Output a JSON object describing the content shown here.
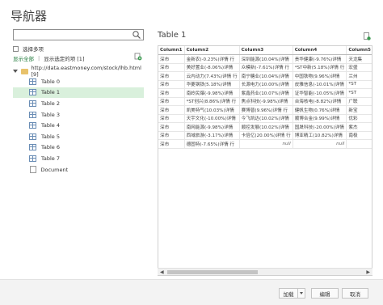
{
  "navigator": {
    "title": "导航器",
    "search_placeholder": "",
    "multi_select_label": "选择多项",
    "show_all_label": "显示全部",
    "show_selected_label": "显示选定的项 [1]",
    "tree": {
      "root_label": "http://data.eastmoney.com/stock/lhb.html [9]",
      "items": [
        {
          "label": "Table 0",
          "type": "table",
          "selected": false
        },
        {
          "label": "Table 1",
          "type": "table",
          "selected": true
        },
        {
          "label": "Table 2",
          "type": "table",
          "selected": false
        },
        {
          "label": "Table 3",
          "type": "table",
          "selected": false
        },
        {
          "label": "Table 4",
          "type": "table",
          "selected": false
        },
        {
          "label": "Table 5",
          "type": "table",
          "selected": false
        },
        {
          "label": "Table 6",
          "type": "table",
          "selected": false
        },
        {
          "label": "Table 7",
          "type": "table",
          "selected": false
        },
        {
          "label": "Document",
          "type": "document",
          "selected": false
        }
      ]
    }
  },
  "preview": {
    "title": "Table 1",
    "columns": [
      "Column1",
      "Column2",
      "Column3",
      "Column4",
      "Column5"
    ],
    "rows": [
      [
        "深市",
        "金新农(-0.23%)详情 行",
        "深圳能源(10.04%)详情",
        "贵华健康(-9.76%)详情",
        "天龙集"
      ],
      [
        "深市",
        "美好置业(-8.06%)详情",
        "众模新(-7.61%)详情 行",
        "*ST中新(5.18%)详情 行",
        "宏盛"
      ],
      [
        "深市",
        "云内动力(7.43%)详情 行",
        "南宁糖业(10.04%)详情",
        "中国铁物(9.96%)详情",
        "兰州"
      ],
      [
        "深市",
        "华菱钢铁(5.18%)详情",
        "长源电力(10.00%)详情",
        "皮雅信息(-10.01%)详情",
        "*ST"
      ],
      [
        "深市",
        "南岭民爆(-9.98%)详情",
        "紫鑫药业(10.07%)详情",
        "证华智能(-10.05%)详情",
        "*ST"
      ],
      [
        "深市",
        "*ST创兴(8.86%)详情 行",
        "焦点科技(-9.98%)详情",
        "台海核电(-8.82%)详情",
        "广联"
      ],
      [
        "深市",
        "凯美特气(10.03%)详情",
        "赛博普(9.96%)详情 行",
        "健帆生物(0.76%)详情",
        "新宝"
      ],
      [
        "深市",
        "天宇文化(-10.00%)详情",
        "今飞凯达(10.02%)详情",
        "顺博合金(9.99%)详情",
        "优彩"
      ],
      [
        "深市",
        "南网能源(-9.98%)详情",
        "顺控发展(10.02%)详情",
        "国晟科技(-20.00%)详情",
        "紫杰"
      ],
      [
        "深市",
        "西域旅游(-3.17%)详情",
        "卡倍亿(20.00%)详情 行",
        "博亚精工(10.82%)详情",
        "南极"
      ],
      [
        "深市",
        "德固特(-7.65%)详情 行",
        "null",
        "null",
        ""
      ]
    ]
  },
  "footer": {
    "load_label": "加载",
    "edit_label": "编辑",
    "cancel_label": "取消"
  }
}
